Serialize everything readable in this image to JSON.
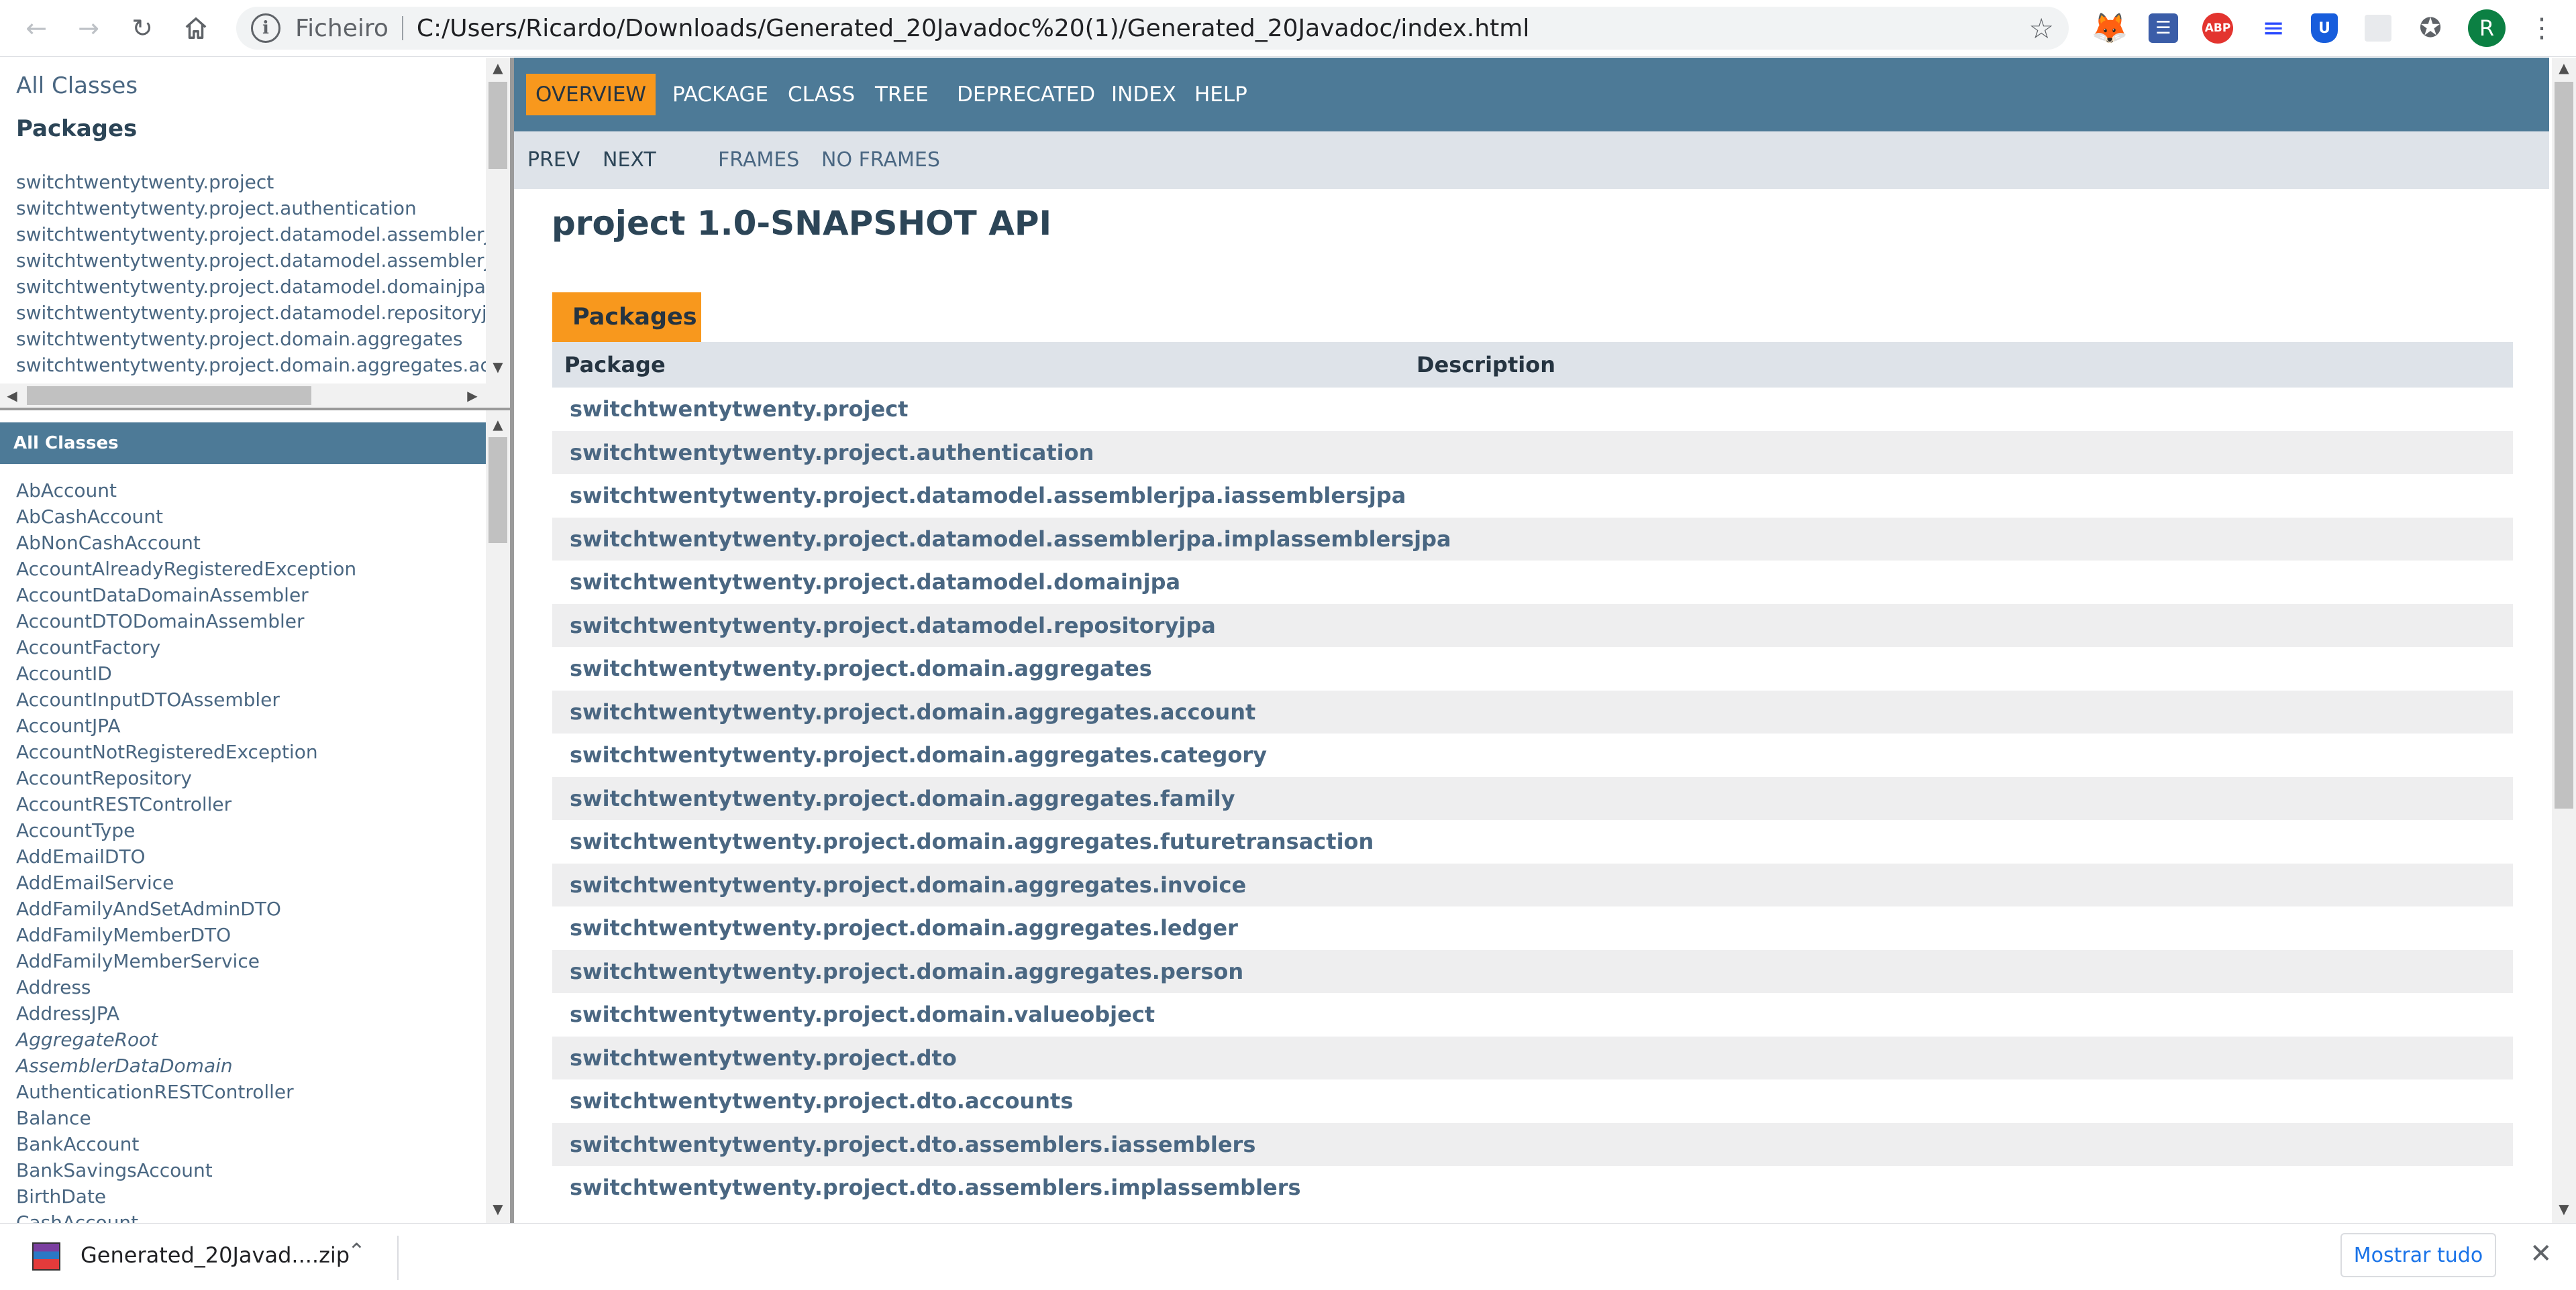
{
  "browser": {
    "scheme_label": "Ficheiro",
    "url": "C:/Users/Ricardo/Downloads/Generated_20Javadoc%20(1)/Generated_20Javadoc/index.html",
    "avatar_initial": "R",
    "ext_abp": "ABP"
  },
  "package_frame": {
    "all_classes_link": "All Classes",
    "title": "Packages",
    "packages": [
      "switchtwentytwenty.project",
      "switchtwentytwenty.project.authentication",
      "switchtwentytwenty.project.datamodel.assemblerjpa.i",
      "switchtwentytwenty.project.datamodel.assemblerjpa.i",
      "switchtwentytwenty.project.datamodel.domainjpa",
      "switchtwentytwenty.project.datamodel.repositoryjpa",
      "switchtwentytwenty.project.domain.aggregates",
      "switchtwentytwenty.project.domain.aggregates.accou"
    ]
  },
  "class_frame": {
    "title": "All Classes",
    "classes": [
      {
        "name": "AbAccount",
        "italic": false
      },
      {
        "name": "AbCashAccount",
        "italic": false
      },
      {
        "name": "AbNonCashAccount",
        "italic": false
      },
      {
        "name": "AccountAlreadyRegisteredException",
        "italic": false
      },
      {
        "name": "AccountDataDomainAssembler",
        "italic": false
      },
      {
        "name": "AccountDTODomainAssembler",
        "italic": false
      },
      {
        "name": "AccountFactory",
        "italic": false
      },
      {
        "name": "AccountID",
        "italic": false
      },
      {
        "name": "AccountInputDTOAssembler",
        "italic": false
      },
      {
        "name": "AccountJPA",
        "italic": false
      },
      {
        "name": "AccountNotRegisteredException",
        "italic": false
      },
      {
        "name": "AccountRepository",
        "italic": false
      },
      {
        "name": "AccountRESTController",
        "italic": false
      },
      {
        "name": "AccountType",
        "italic": false
      },
      {
        "name": "AddEmailDTO",
        "italic": false
      },
      {
        "name": "AddEmailService",
        "italic": false
      },
      {
        "name": "AddFamilyAndSetAdminDTO",
        "italic": false
      },
      {
        "name": "AddFamilyMemberDTO",
        "italic": false
      },
      {
        "name": "AddFamilyMemberService",
        "italic": false
      },
      {
        "name": "Address",
        "italic": false
      },
      {
        "name": "AddressJPA",
        "italic": false
      },
      {
        "name": "AggregateRoot",
        "italic": true
      },
      {
        "name": "AssemblerDataDomain",
        "italic": true
      },
      {
        "name": "AuthenticationRESTController",
        "italic": false
      },
      {
        "name": "Balance",
        "italic": false
      },
      {
        "name": "BankAccount",
        "italic": false
      },
      {
        "name": "BankSavingsAccount",
        "italic": false
      },
      {
        "name": "BirthDate",
        "italic": false
      },
      {
        "name": "CashAccount",
        "italic": false
      }
    ]
  },
  "main_frame": {
    "nav_tabs": [
      "OVERVIEW",
      "PACKAGE",
      "CLASS",
      "TREE",
      "DEPRECATED",
      "INDEX",
      "HELP"
    ],
    "sub_nav": {
      "prev": "PREV",
      "next": "NEXT",
      "frames": "FRAMES",
      "no_frames": "NO FRAMES"
    },
    "title": "project 1.0-SNAPSHOT API",
    "caption": "Packages",
    "table_headers": {
      "package": "Package",
      "description": "Description"
    },
    "packages": [
      "switchtwentytwenty.project",
      "switchtwentytwenty.project.authentication",
      "switchtwentytwenty.project.datamodel.assemblerjpa.iassemblersjpa",
      "switchtwentytwenty.project.datamodel.assemblerjpa.implassemblersjpa",
      "switchtwentytwenty.project.datamodel.domainjpa",
      "switchtwentytwenty.project.datamodel.repositoryjpa",
      "switchtwentytwenty.project.domain.aggregates",
      "switchtwentytwenty.project.domain.aggregates.account",
      "switchtwentytwenty.project.domain.aggregates.category",
      "switchtwentytwenty.project.domain.aggregates.family",
      "switchtwentytwenty.project.domain.aggregates.futuretransaction",
      "switchtwentytwenty.project.domain.aggregates.invoice",
      "switchtwentytwenty.project.domain.aggregates.ledger",
      "switchtwentytwenty.project.domain.aggregates.person",
      "switchtwentytwenty.project.domain.valueobject",
      "switchtwentytwenty.project.dto",
      "switchtwentytwenty.project.dto.accounts",
      "switchtwentytwenty.project.dto.assemblers.iassemblers",
      "switchtwentytwenty.project.dto.assemblers.implassemblers"
    ]
  },
  "downloads": {
    "file_name": "Generated_20Javad....zip",
    "show_all": "Mostrar tudo"
  },
  "colors": {
    "nav_blue": "#4d7a97",
    "accent_orange": "#f8981d",
    "link": "#4a6782",
    "subnav_bg": "#dee3e9"
  }
}
